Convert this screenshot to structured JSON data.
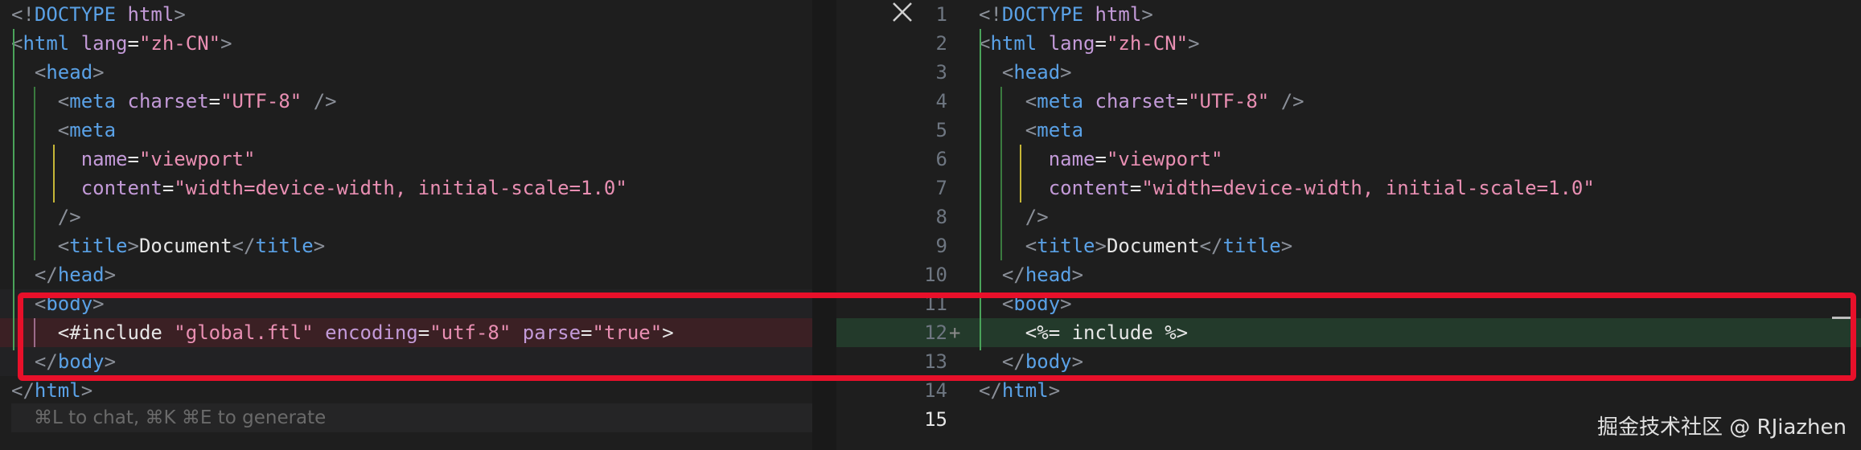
{
  "left_pane": {
    "lines": [
      {
        "parts": [
          [
            "ang",
            "<!"
          ],
          [
            "tag",
            "DOCTYPE"
          ],
          [
            "txt",
            " "
          ],
          [
            "attr",
            "html"
          ],
          [
            "ang",
            ">"
          ]
        ]
      },
      {
        "parts": [
          [
            "ang",
            "<"
          ],
          [
            "tag",
            "html"
          ],
          [
            "txt",
            " "
          ],
          [
            "attr",
            "lang"
          ],
          [
            "txt",
            "="
          ],
          [
            "str",
            "\"zh-CN\""
          ],
          [
            "ang",
            ">"
          ]
        ]
      },
      {
        "parts": [
          [
            "txt",
            "  "
          ],
          [
            "ang",
            "<"
          ],
          [
            "tag",
            "head"
          ],
          [
            "ang",
            ">"
          ]
        ]
      },
      {
        "parts": [
          [
            "txt",
            "    "
          ],
          [
            "ang",
            "<"
          ],
          [
            "tag",
            "meta"
          ],
          [
            "txt",
            " "
          ],
          [
            "attr",
            "charset"
          ],
          [
            "txt",
            "="
          ],
          [
            "str",
            "\"UTF-8\""
          ],
          [
            "txt",
            " "
          ],
          [
            "ang",
            "/>"
          ]
        ]
      },
      {
        "parts": [
          [
            "txt",
            "    "
          ],
          [
            "ang",
            "<"
          ],
          [
            "tag",
            "meta"
          ]
        ]
      },
      {
        "parts": [
          [
            "txt",
            "      "
          ],
          [
            "attr",
            "name"
          ],
          [
            "txt",
            "="
          ],
          [
            "str",
            "\"viewport\""
          ]
        ]
      },
      {
        "parts": [
          [
            "txt",
            "      "
          ],
          [
            "attr",
            "content"
          ],
          [
            "txt",
            "="
          ],
          [
            "str",
            "\"width=device-width, initial-scale=1.0\""
          ]
        ]
      },
      {
        "parts": [
          [
            "txt",
            "    "
          ],
          [
            "ang",
            "/>"
          ]
        ]
      },
      {
        "parts": [
          [
            "txt",
            "    "
          ],
          [
            "ang",
            "<"
          ],
          [
            "tag",
            "title"
          ],
          [
            "ang",
            ">"
          ],
          [
            "txt",
            "Document"
          ],
          [
            "ang",
            "</"
          ],
          [
            "tag",
            "title"
          ],
          [
            "ang",
            ">"
          ]
        ]
      },
      {
        "parts": [
          [
            "txt",
            "  "
          ],
          [
            "ang",
            "</"
          ],
          [
            "tag",
            "head"
          ],
          [
            "ang",
            ">"
          ]
        ]
      },
      {
        "parts": [
          [
            "txt",
            "  "
          ],
          [
            "ang",
            "<"
          ],
          [
            "tag",
            "body"
          ],
          [
            "ang",
            ">"
          ]
        ]
      },
      {
        "parts": [
          [
            "txt",
            "    "
          ],
          [
            "txt",
            "<#include "
          ],
          [
            "str",
            "\"global.ftl\""
          ],
          [
            "txt",
            " "
          ],
          [
            "attr",
            "encoding"
          ],
          [
            "txt",
            "="
          ],
          [
            "str",
            "\"utf-8\""
          ],
          [
            "txt",
            " "
          ],
          [
            "attr",
            "parse"
          ],
          [
            "txt",
            "="
          ],
          [
            "str",
            "\"true\""
          ],
          [
            "txt",
            ">"
          ]
        ]
      },
      {
        "parts": [
          [
            "txt",
            "  "
          ],
          [
            "ang",
            "</"
          ],
          [
            "tag",
            "body"
          ],
          [
            "ang",
            ">"
          ]
        ]
      },
      {
        "parts": [
          [
            "ang",
            "</"
          ],
          [
            "tag",
            "html"
          ],
          [
            "ang",
            ">"
          ]
        ]
      }
    ],
    "hint": "⌘L to chat, ⌘K ⌘E to generate"
  },
  "right_pane": {
    "line_numbers": [
      "1",
      "2",
      "3",
      "4",
      "5",
      "6",
      "7",
      "8",
      "9",
      "10",
      "11",
      "12",
      "13",
      "14",
      "15"
    ],
    "active_line": "15",
    "added_marker": "+",
    "lines": [
      {
        "parts": [
          [
            "ang",
            "<!"
          ],
          [
            "tag",
            "DOCTYPE"
          ],
          [
            "txt",
            " "
          ],
          [
            "attr",
            "html"
          ],
          [
            "ang",
            ">"
          ]
        ]
      },
      {
        "parts": [
          [
            "ang",
            "<"
          ],
          [
            "tag",
            "html"
          ],
          [
            "txt",
            " "
          ],
          [
            "attr",
            "lang"
          ],
          [
            "txt",
            "="
          ],
          [
            "str",
            "\"zh-CN\""
          ],
          [
            "ang",
            ">"
          ]
        ]
      },
      {
        "parts": [
          [
            "txt",
            "  "
          ],
          [
            "ang",
            "<"
          ],
          [
            "tag",
            "head"
          ],
          [
            "ang",
            ">"
          ]
        ]
      },
      {
        "parts": [
          [
            "txt",
            "    "
          ],
          [
            "ang",
            "<"
          ],
          [
            "tag",
            "meta"
          ],
          [
            "txt",
            " "
          ],
          [
            "attr",
            "charset"
          ],
          [
            "txt",
            "="
          ],
          [
            "str",
            "\"UTF-8\""
          ],
          [
            "txt",
            " "
          ],
          [
            "ang",
            "/>"
          ]
        ]
      },
      {
        "parts": [
          [
            "txt",
            "    "
          ],
          [
            "ang",
            "<"
          ],
          [
            "tag",
            "meta"
          ]
        ]
      },
      {
        "parts": [
          [
            "txt",
            "      "
          ],
          [
            "attr",
            "name"
          ],
          [
            "txt",
            "="
          ],
          [
            "str",
            "\"viewport\""
          ]
        ]
      },
      {
        "parts": [
          [
            "txt",
            "      "
          ],
          [
            "attr",
            "content"
          ],
          [
            "txt",
            "="
          ],
          [
            "str",
            "\"width=device-width, initial-scale=1.0\""
          ]
        ]
      },
      {
        "parts": [
          [
            "txt",
            "    "
          ],
          [
            "ang",
            "/>"
          ]
        ]
      },
      {
        "parts": [
          [
            "txt",
            "    "
          ],
          [
            "ang",
            "<"
          ],
          [
            "tag",
            "title"
          ],
          [
            "ang",
            ">"
          ],
          [
            "txt",
            "Document"
          ],
          [
            "ang",
            "</"
          ],
          [
            "tag",
            "title"
          ],
          [
            "ang",
            ">"
          ]
        ]
      },
      {
        "parts": [
          [
            "txt",
            "  "
          ],
          [
            "ang",
            "</"
          ],
          [
            "tag",
            "head"
          ],
          [
            "ang",
            ">"
          ]
        ]
      },
      {
        "parts": [
          [
            "txt",
            "  "
          ],
          [
            "ang",
            "<"
          ],
          [
            "tag",
            "body"
          ],
          [
            "ang",
            ">"
          ]
        ]
      },
      {
        "parts": [
          [
            "txt",
            "    "
          ],
          [
            "txt",
            "<%= include %>"
          ]
        ]
      },
      {
        "parts": [
          [
            "txt",
            "  "
          ],
          [
            "ang",
            "</"
          ],
          [
            "tag",
            "body"
          ],
          [
            "ang",
            ">"
          ]
        ]
      },
      {
        "parts": [
          [
            "ang",
            "</"
          ],
          [
            "tag",
            "html"
          ],
          [
            "ang",
            ">"
          ]
        ]
      },
      {
        "parts": []
      }
    ]
  },
  "watermark": "掘金技术社区 @ RJiazhen",
  "colors": {
    "highlight_box": "#e8102a",
    "removed_line": "#3b2024",
    "added_line": "#233a2b"
  }
}
